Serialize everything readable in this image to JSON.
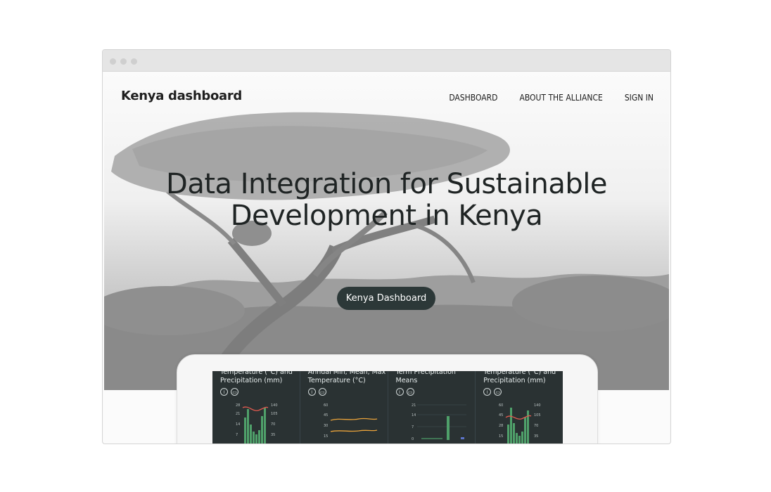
{
  "brand": "Kenya dashboard",
  "nav": {
    "links": [
      "DASHBOARD",
      "ABOUT THE ALLIANCE",
      "SIGN IN"
    ]
  },
  "hero": {
    "title_line1": "Data Integration for Sustainable",
    "title_line2": "Development in Kenya",
    "cta": "Kenya Dashboard"
  },
  "preview": {
    "panels": [
      {
        "title1": "Temperature (°C) and",
        "title2": "Precipitation (mm)",
        "yleft": [
          "28",
          "21",
          "14",
          "7"
        ],
        "yright": [
          "140",
          "105",
          "70",
          "35"
        ]
      },
      {
        "title1": "Annual Min, Mean, Max",
        "title2": "Temperature (°C)",
        "yleft": [
          "60",
          "45",
          "30",
          "15"
        ],
        "yright": []
      },
      {
        "title1": "Term Precipitation",
        "title2": "Means",
        "yleft": [
          "21",
          "14",
          "7",
          "0"
        ],
        "yright": []
      },
      {
        "title1": "Temperature (°C) and",
        "title2": "Precipitation (mm)",
        "yleft": [
          "60",
          "45",
          "28",
          "15"
        ],
        "yright": [
          "140",
          "105",
          "70",
          "35"
        ]
      }
    ],
    "info_icon": "info-icon",
    "print_icon": "print-icon"
  },
  "colors": {
    "cta_bg": "#2c3838",
    "screen_bg": "#2a3233",
    "temp_line": "#e05a4f",
    "min_max_line": "#e8a23a",
    "precip_bar": "#4fa06a"
  }
}
